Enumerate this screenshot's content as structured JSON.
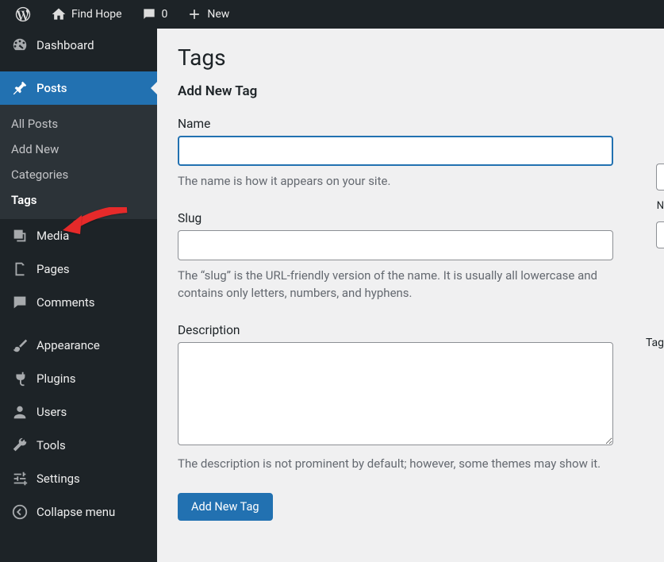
{
  "adminbar": {
    "site_name": "Find Hope",
    "comments_count": "0",
    "new_label": "New"
  },
  "sidebar": {
    "dashboard": "Dashboard",
    "posts": "Posts",
    "posts_sub": {
      "all": "All Posts",
      "add": "Add New",
      "categories": "Categories",
      "tags": "Tags"
    },
    "media": "Media",
    "pages": "Pages",
    "comments": "Comments",
    "appearance": "Appearance",
    "plugins": "Plugins",
    "users": "Users",
    "tools": "Tools",
    "settings": "Settings",
    "collapse": "Collapse menu"
  },
  "main": {
    "title": "Tags",
    "subtitle": "Add New Tag",
    "name_label": "Name",
    "name_desc": "The name is how it appears on your site.",
    "slug_label": "Slug",
    "slug_desc": "The “slug” is the URL-friendly version of the name. It is usually all lowercase and contains only letters, numbers, and hyphens.",
    "desc_label": "Description",
    "desc_desc": "The description is not prominent by default; however, some themes may show it.",
    "submit": "Add New Tag"
  },
  "side": {
    "n_label": "N",
    "tag_label": "Tag"
  }
}
